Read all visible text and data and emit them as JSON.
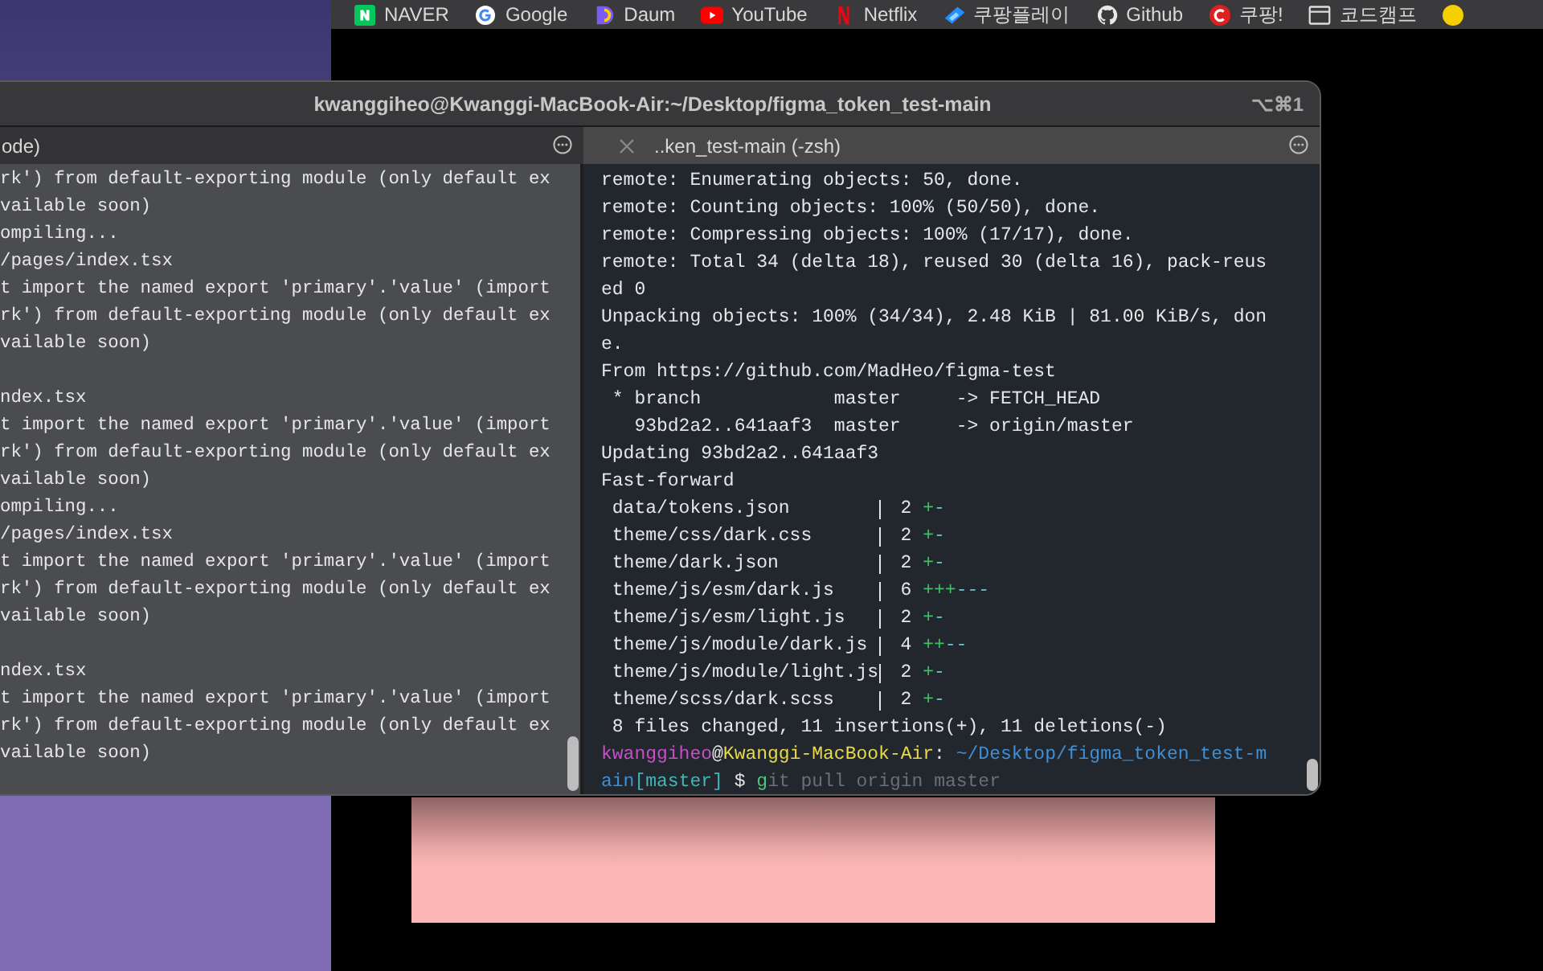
{
  "bookmarks": [
    {
      "kind": "naver",
      "label": "NAVER"
    },
    {
      "kind": "google",
      "label": "Google"
    },
    {
      "kind": "daum",
      "label": "Daum"
    },
    {
      "kind": "youtube",
      "label": "YouTube"
    },
    {
      "kind": "netflix",
      "label": "Netflix"
    },
    {
      "kind": "coupangplay",
      "label": "쿠팡플레이"
    },
    {
      "kind": "github",
      "label": "Github"
    },
    {
      "kind": "coupang",
      "label": "쿠팡!"
    },
    {
      "kind": "folder",
      "label": "코드캠프"
    },
    {
      "kind": "emoji"
    }
  ],
  "window": {
    "title": "kwanggiheo@Kwanggi-MacBook-Air:~/Desktop/figma_token_test-main",
    "shortcut": "⌥⌘1"
  },
  "tabs": [
    {
      "label": "ode)",
      "selected": false
    },
    {
      "label": "..ken_test-main (-zsh)",
      "selected": true
    }
  ],
  "left_pane": {
    "blocks": [
      [
        "rk') from default-exporting module (only default ex",
        "vailable soon)",
        "ompiling...",
        "/pages/index.tsx",
        "t import the named export 'primary'.'value' (import",
        "rk') from default-exporting module (only default ex",
        "vailable soon)"
      ],
      [
        "ndex.tsx",
        "t import the named export 'primary'.'value' (import",
        "rk') from default-exporting module (only default ex",
        "vailable soon)",
        "ompiling...",
        "/pages/index.tsx",
        "t import the named export 'primary'.'value' (import",
        "rk') from default-exporting module (only default ex",
        "vailable soon)"
      ],
      [
        "ndex.tsx",
        "t import the named export 'primary'.'value' (import",
        "rk') from default-exporting module (only default ex",
        "vailable soon)"
      ]
    ]
  },
  "right_pane": {
    "lines": [
      {
        "kind": "text",
        "text": "remote: Enumerating objects: 50, done."
      },
      {
        "kind": "text",
        "text": "remote: Counting objects: 100% (50/50), done."
      },
      {
        "kind": "text",
        "text": "remote: Compressing objects: 100% (17/17), done."
      },
      {
        "kind": "text",
        "text": "remote: Total 34 (delta 18), reused 30 (delta 16), pack-reus"
      },
      {
        "kind": "text",
        "text": "ed 0"
      },
      {
        "kind": "text",
        "text": "Unpacking objects: 100% (34/34), 2.48 KiB | 81.00 KiB/s, don"
      },
      {
        "kind": "text",
        "text": "e."
      },
      {
        "kind": "text",
        "text": "From https://github.com/MadHeo/figma-test"
      },
      {
        "kind": "text",
        "text": " * branch            master     -> FETCH_HEAD"
      },
      {
        "kind": "text",
        "text": "   93bd2a2..641aaf3  master     -> origin/master"
      },
      {
        "kind": "text",
        "text": "Updating 93bd2a2..641aaf3"
      },
      {
        "kind": "text",
        "text": "Fast-forward"
      },
      {
        "kind": "stat",
        "file": "data/tokens.json",
        "count": "2",
        "plus": "+",
        "minus": "-"
      },
      {
        "kind": "stat",
        "file": "theme/css/dark.css",
        "count": "2",
        "plus": "+",
        "minus": "-"
      },
      {
        "kind": "stat",
        "file": "theme/dark.json",
        "count": "2",
        "plus": "+",
        "minus": "-"
      },
      {
        "kind": "stat",
        "file": "theme/js/esm/dark.js",
        "count": "6",
        "plus": "+++",
        "minus": "---"
      },
      {
        "kind": "stat",
        "file": "theme/js/esm/light.js",
        "count": "2",
        "plus": "+",
        "minus": "-"
      },
      {
        "kind": "stat",
        "file": "theme/js/module/dark.js",
        "count": "4",
        "plus": "++",
        "minus": "--"
      },
      {
        "kind": "stat",
        "file": "theme/js/module/light.js",
        "count": "2",
        "plus": "+",
        "minus": "-"
      },
      {
        "kind": "stat",
        "file": "theme/scss/dark.scss",
        "count": "2",
        "plus": "+",
        "minus": "-"
      },
      {
        "kind": "text",
        "text": " 8 files changed, 11 insertions(+), 11 deletions(-)"
      },
      {
        "kind": "prompt",
        "user": "kwanggiheo",
        "at": "@",
        "host": "Kwanggi-MacBook-Air",
        "colon": ":",
        "path": "~/Desktop/figma_token_test-m"
      },
      {
        "kind": "prompt_end",
        "path": "ain",
        "branch": "[master]",
        "dollar": "$",
        "typed": "g",
        "suggestion": "it pull origin master"
      }
    ]
  }
}
